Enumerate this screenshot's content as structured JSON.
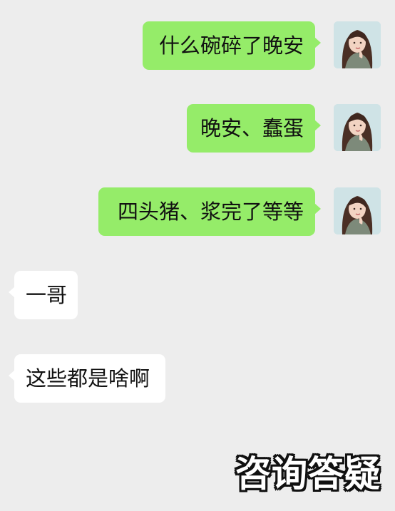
{
  "messages": [
    {
      "direction": "outgoing",
      "text": "什么碗碎了晚安"
    },
    {
      "direction": "outgoing",
      "text": "晚安、蠢蛋"
    },
    {
      "direction": "outgoing",
      "text": "四头猪、浆完了等等"
    },
    {
      "direction": "incoming",
      "text": "一哥"
    },
    {
      "direction": "incoming",
      "text": "这些都是啥啊"
    }
  ],
  "watermark": "咨询答疑",
  "colors": {
    "background": "#ededed",
    "outgoing_bubble": "#95ec69",
    "incoming_bubble": "#ffffff"
  },
  "avatar_icon": "girl-portrait-avatar"
}
